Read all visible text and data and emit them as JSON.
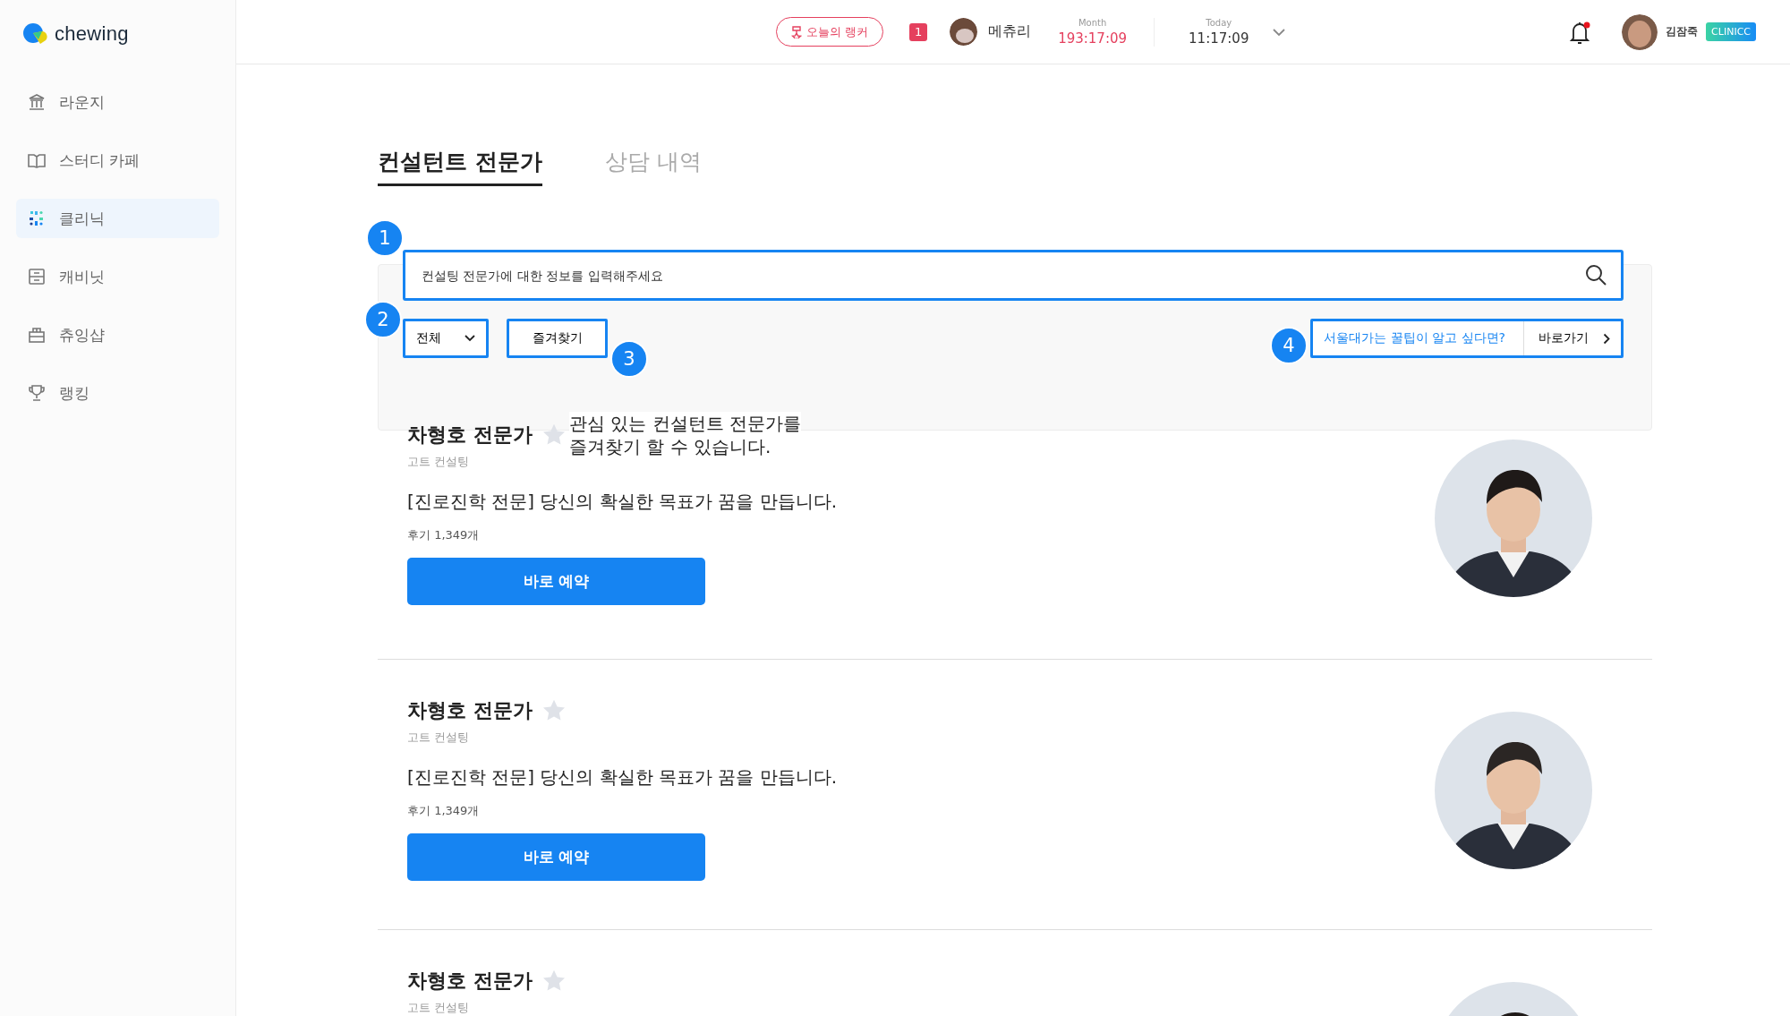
{
  "sidebar": {
    "logo": "chewing",
    "items": [
      {
        "label": "라운지",
        "kind": "lounge",
        "selected": false
      },
      {
        "label": "스터디 카페",
        "kind": "book",
        "selected": false
      },
      {
        "label": "클리닉",
        "kind": "dots",
        "selected": true
      },
      {
        "label": "캐비닛",
        "kind": "cabinet",
        "selected": false
      },
      {
        "label": "츄잉샵",
        "kind": "shop",
        "selected": false
      },
      {
        "label": "랭킹",
        "kind": "trophy",
        "selected": false
      }
    ]
  },
  "topbar": {
    "ranker_button": "오늘의 랭커",
    "rank": "1",
    "ranker_name": "메츄리",
    "timers": [
      {
        "label": "Month",
        "value": "193:17:09",
        "accent": true
      },
      {
        "label": "Today",
        "value": "11:17:09",
        "accent": false
      }
    ],
    "notification": {
      "unread": true
    },
    "user": {
      "name": "김잠죽",
      "badge": "CLINICC"
    }
  },
  "tabs": [
    {
      "label": "컨설턴트 전문가",
      "selected": true
    },
    {
      "label": "상담 내역",
      "selected": false
    }
  ],
  "search": {
    "placeholder": "컨설팅 전문가에 대한 정보를 입력해주세요"
  },
  "filter": {
    "value": "전체"
  },
  "favorites_button": "즐겨찾기",
  "promo": {
    "text": "서울대가는 꿀팁이 알고 싶다면?",
    "action": "바로가기"
  },
  "callouts": [
    "1",
    "2",
    "3",
    "4"
  ],
  "tooltip": "관심 있는 컨설턴트 전문가를\n즐겨찾기 할 수 있습니다.",
  "experts": [
    {
      "name": "차형호 전문가",
      "favorite": false,
      "company": "고트 컨설팅",
      "headline": "[진로진학 전문] 당신의 확실한 목표가 꿈을 만듭니다.",
      "reviews": "후기 1,349개",
      "button": "바로 예약"
    },
    {
      "name": "차형호 전문가",
      "favorite": false,
      "company": "고트 컨설팅",
      "headline": "[진로진학 전문] 당신의 확실한 목표가 꿈을 만듭니다.",
      "reviews": "후기 1,349개",
      "button": "바로 예약"
    },
    {
      "name": "차형호 전문가",
      "favorite": false,
      "company": "고트 컨설팅"
    }
  ]
}
